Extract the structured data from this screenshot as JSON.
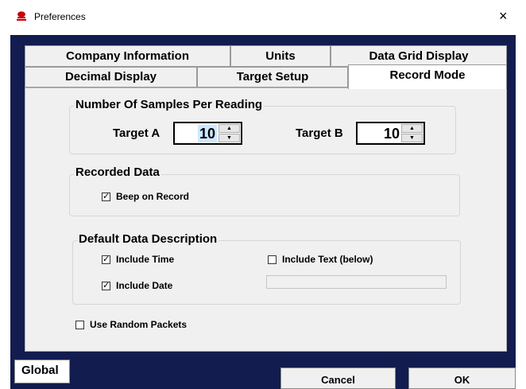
{
  "window": {
    "title": "Preferences",
    "close": "×"
  },
  "tabs": {
    "row1": [
      "Company Information",
      "Units",
      "Data Grid Display"
    ],
    "row2": [
      "Decimal Display",
      "Target Setup",
      "Record Mode"
    ]
  },
  "samples": {
    "legend": "Number Of Samples Per Reading",
    "target_a": {
      "label": "Target A",
      "value": "10"
    },
    "target_b": {
      "label": "Target B",
      "value": "10"
    }
  },
  "recorded": {
    "legend": "Recorded Data",
    "beep": {
      "label": "Beep on Record",
      "checked": true
    }
  },
  "default_desc": {
    "legend": "Default Data Description",
    "include_time": {
      "label": "Include Time",
      "checked": true
    },
    "include_date": {
      "label": "Include Date",
      "checked": true
    },
    "include_text": {
      "label": "Include Text (below)",
      "checked": false
    },
    "text_value": ""
  },
  "random_packets": {
    "label": "Use Random Packets",
    "checked": false
  },
  "footer": {
    "global": "Global",
    "cancel": "Cancel",
    "ok": "OK"
  },
  "colors": {
    "dialog_bg": "#121c4e",
    "panel_bg": "#f0f0f0",
    "selection": "#cde8ff",
    "app_icon": "#c8000a"
  }
}
